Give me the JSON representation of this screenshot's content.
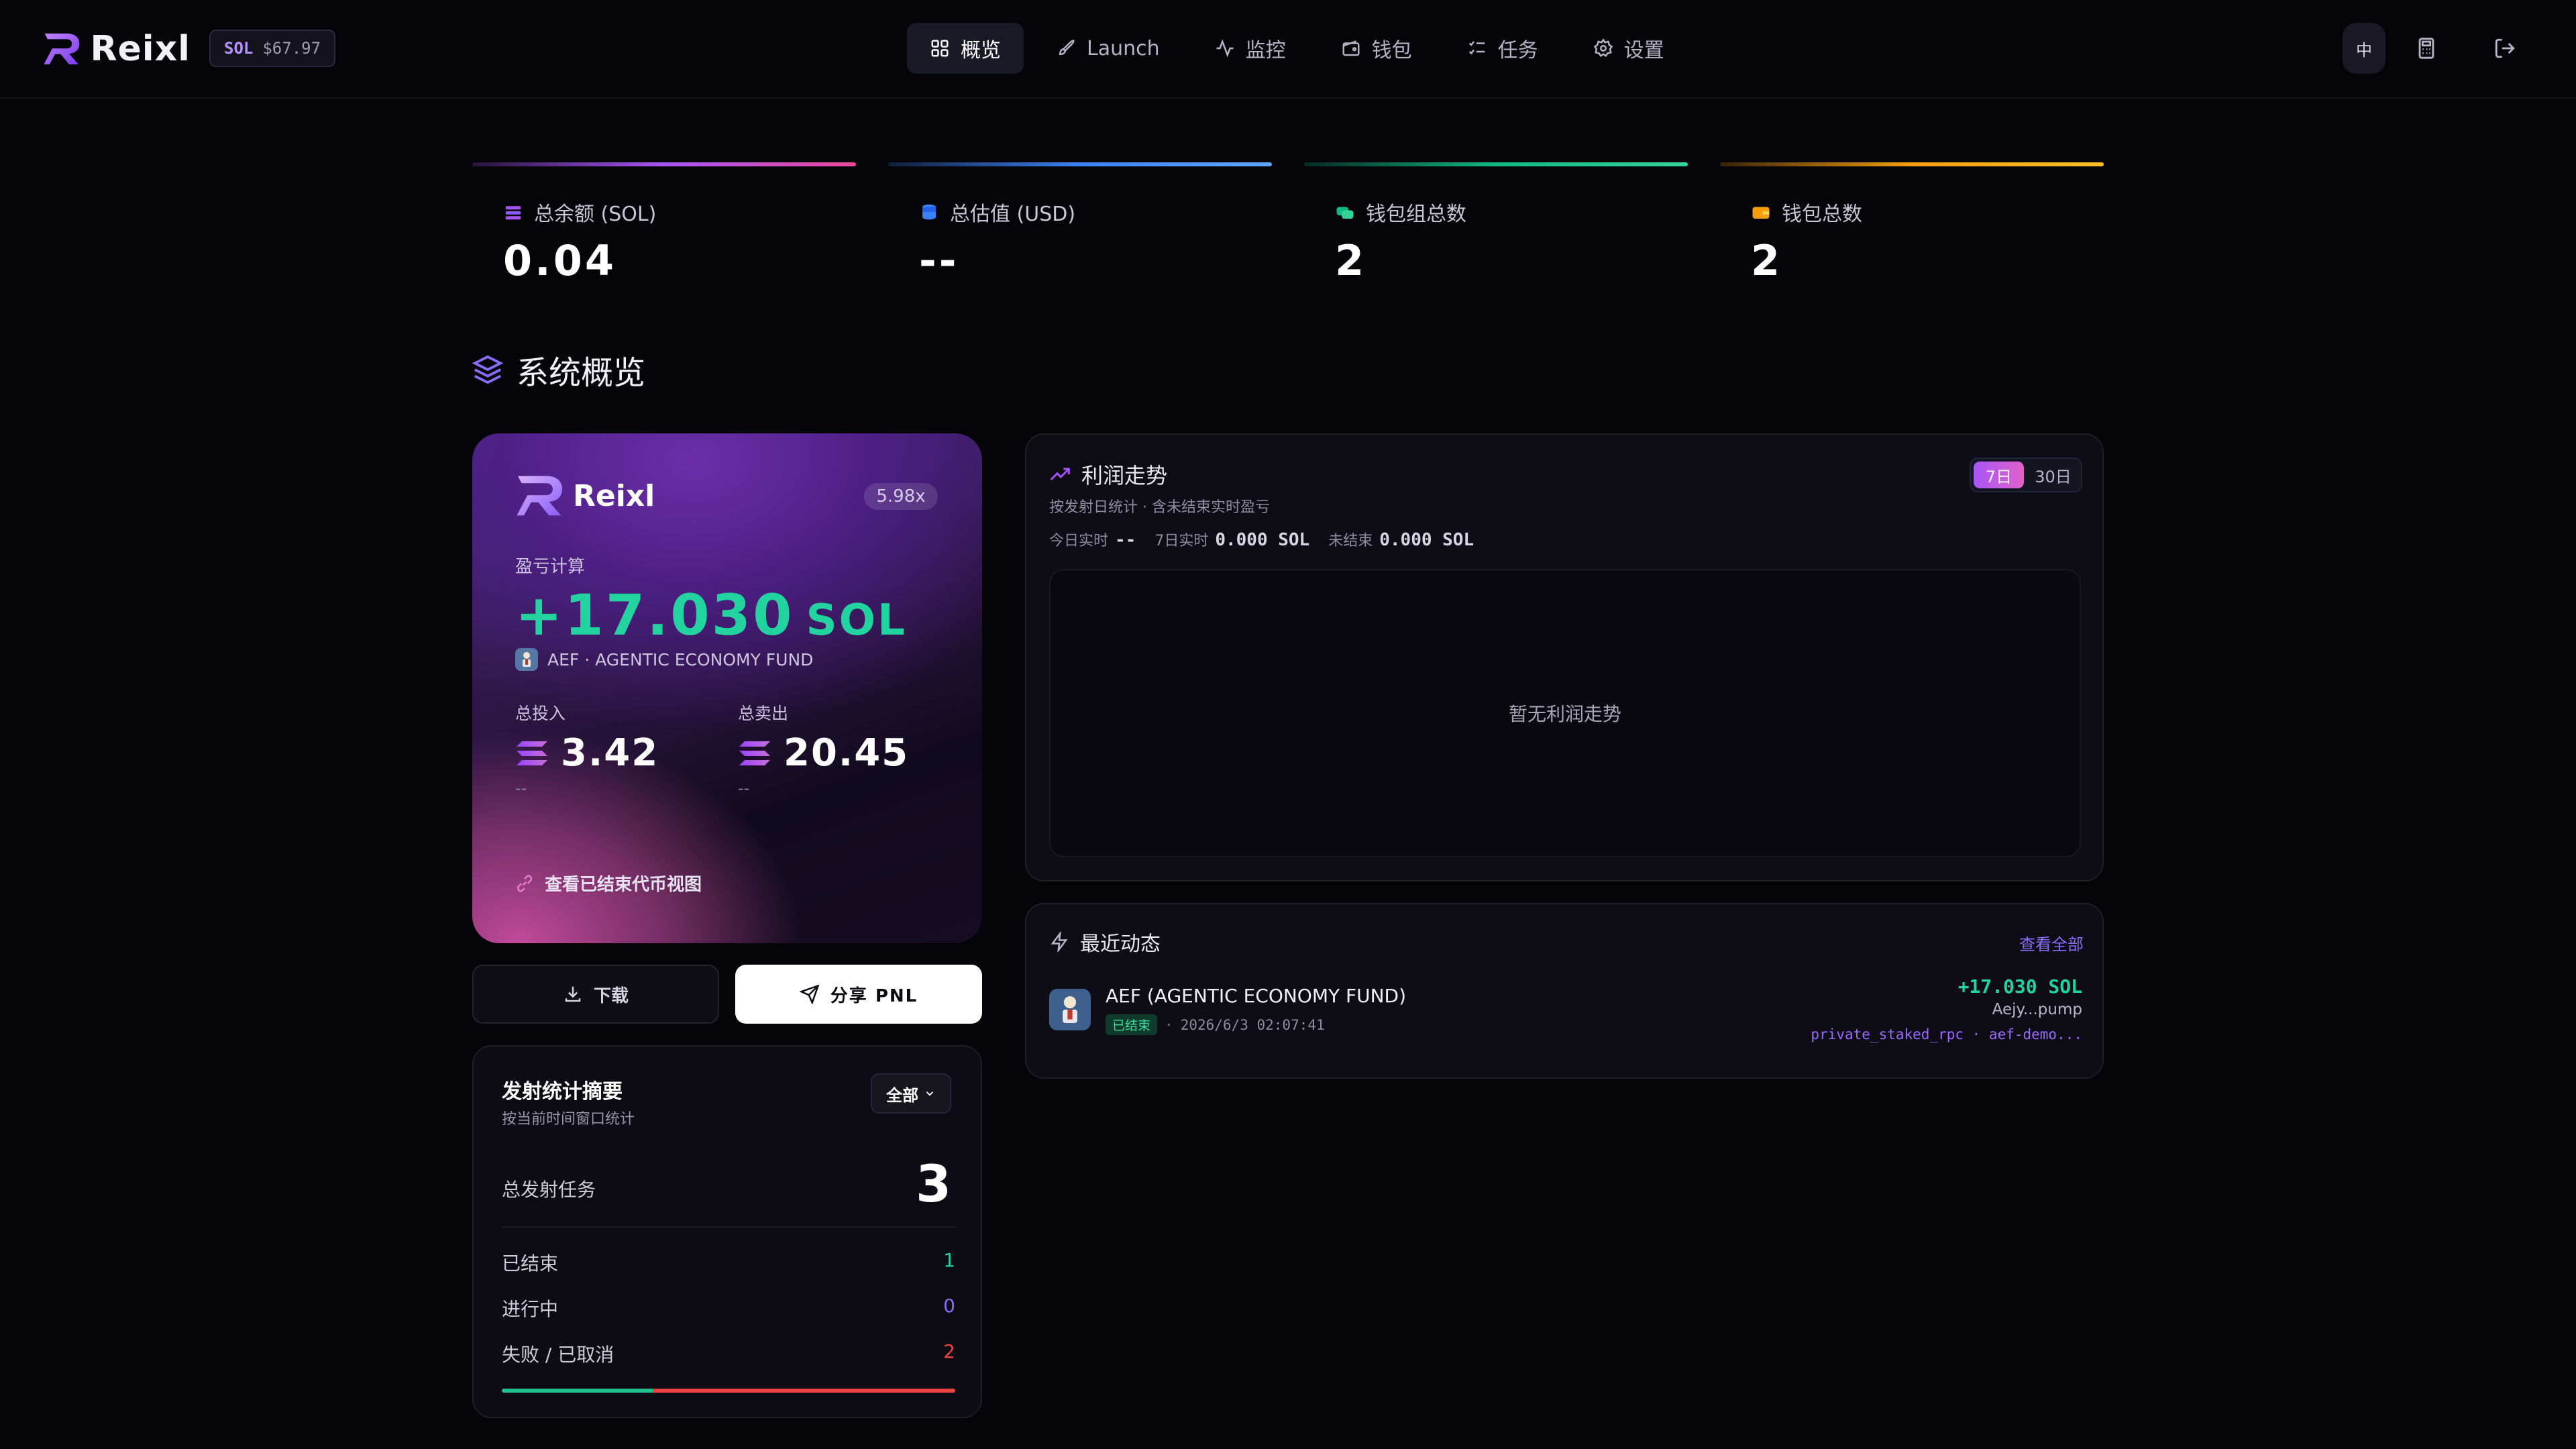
{
  "brand": {
    "name": "Reixl"
  },
  "price": {
    "ticker": "SOL",
    "value": "$67.97"
  },
  "nav": [
    {
      "label": "概览",
      "icon": "grid-icon"
    },
    {
      "label": "Launch",
      "icon": "rocket-icon"
    },
    {
      "label": "监控",
      "icon": "activity-icon"
    },
    {
      "label": "钱包",
      "icon": "wallet-icon"
    },
    {
      "label": "任务",
      "icon": "tasks-icon"
    },
    {
      "label": "设置",
      "icon": "gear-icon"
    }
  ],
  "topbar": {
    "lang": "中"
  },
  "stats": [
    {
      "label": "总余额 (SOL)",
      "value": "0.04",
      "accent": "#a855f7"
    },
    {
      "label": "总估值 (USD)",
      "value": "--",
      "accent": "#3b82f6"
    },
    {
      "label": "钱包组总数",
      "value": "2",
      "accent": "#10b981"
    },
    {
      "label": "钱包总数",
      "value": "2",
      "accent": "#f59e0b"
    }
  ],
  "section": {
    "title": "系统概览"
  },
  "pnl_card": {
    "brand": "Reixl",
    "leverage": "5.98x",
    "label": "盈亏计算",
    "value": "+17.030",
    "unit": "SOL",
    "token": "AEF · AGENTIC ECONOMY FUND",
    "invested_label": "总投入",
    "invested_value": "3.42",
    "invested_sub": "--",
    "sold_label": "总卖出",
    "sold_value": "20.45",
    "sold_sub": "--",
    "link": "查看已结束代币视图"
  },
  "actions": {
    "download": "下载",
    "share": "分享 PNL"
  },
  "summary": {
    "title": "发射统计摘要",
    "subtitle": "按当前时间窗口统计",
    "filter": "全部",
    "total_label": "总发射任务",
    "total_value": "3",
    "rows": [
      {
        "label": "已结束",
        "value": "1",
        "color": "#22d3a0"
      },
      {
        "label": "进行中",
        "value": "0",
        "color": "#8b6cff"
      },
      {
        "label": "失败 / 已取消",
        "value": "2",
        "color": "#ef4444"
      }
    ],
    "bar": [
      {
        "fraction": 0.333,
        "color": "#1fbf8f"
      },
      {
        "fraction": 0.667,
        "color": "#ef4444"
      }
    ]
  },
  "trend": {
    "title": "利润走势",
    "subtitle": "按发射日统计 · 含未结束实时盈亏",
    "tabs": [
      "7日",
      "30日"
    ],
    "active_tab": "7日",
    "today_label": "今日实时",
    "today_value": "--",
    "week_label": "7日实时",
    "week_value": "0.000 SOL",
    "open_label": "未结束",
    "open_value": "0.000 SOL",
    "empty": "暂无利润走势"
  },
  "recent": {
    "title": "最近动态",
    "view_all": "查看全部",
    "item": {
      "name": "AEF (AGENTIC ECONOMY FUND)",
      "status": "已结束",
      "time": "2026/6/3 02:07:41",
      "pnl": "+17.030 SOL",
      "wallet": "Aejy...pump",
      "tags": "private_staked_rpc · aef-demo..."
    }
  }
}
